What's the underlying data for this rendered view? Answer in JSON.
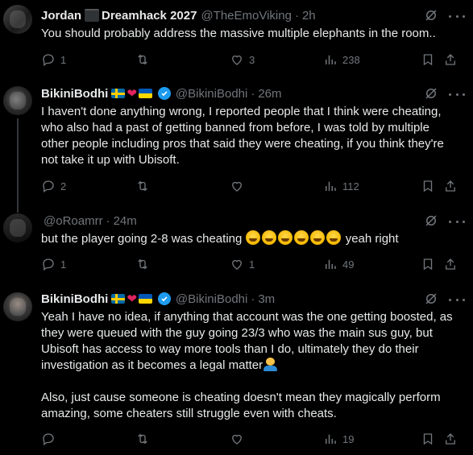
{
  "tweets": [
    {
      "name": "Jordan",
      "name_suffix": "Dreamhack 2027",
      "handle": "@TheEmoViking",
      "time": "2h",
      "text": [
        "You should probably address the massive multiple elephants in the room.."
      ],
      "replies": "1",
      "retweets": "",
      "likes": "3",
      "views": "238"
    },
    {
      "name": "BikiniBodhi",
      "handle": "@BikiniBodhi",
      "time": "26m",
      "text": [
        "I haven't done anything wrong, I reported people that I think were cheating, who also had a past of getting banned from before, I was told by multiple other people including pros that said they were cheating, if you think they're not take it up with Ubisoft."
      ],
      "replies": "2",
      "retweets": "",
      "likes": "",
      "views": "112"
    },
    {
      "name": "",
      "handle": "@oRoamrr",
      "time": "24m",
      "text_before": "but the player going 2-8 was cheating",
      "text_after": "yeah right",
      "replies": "1",
      "retweets": "",
      "likes": "1",
      "views": "49"
    },
    {
      "name": "BikiniBodhi",
      "handle": "@BikiniBodhi",
      "time": "3m",
      "text": [
        "Yeah I have no idea, if anything that account was the one getting boosted, as they were queued with the guy going 23/3 who was the main sus guy, but Ubisoft has access to way more tools than I do, ultimately they do their investigation as it becomes a legal matter",
        "Also, just cause someone is cheating doesn't mean they magically perform amazing, some cheaters still struggle even with cheats."
      ],
      "replies": "",
      "retweets": "",
      "likes": "",
      "views": "19"
    }
  ],
  "colors": {
    "background": "#000000",
    "text": "#e7e9ea",
    "muted": "#71767b",
    "verified": "#1d9bf0",
    "heart": "#e0245e"
  }
}
